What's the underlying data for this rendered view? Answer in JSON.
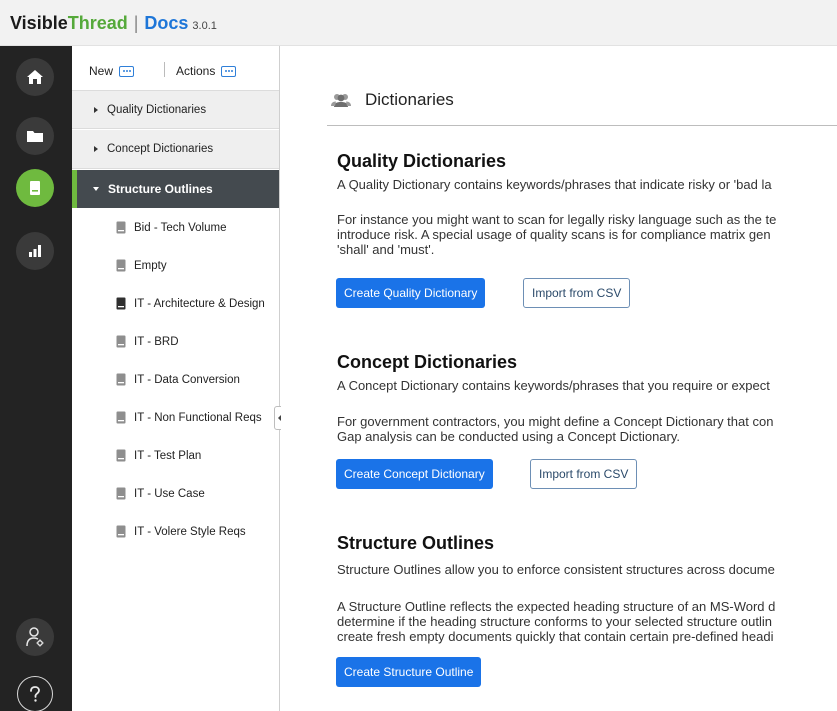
{
  "header": {
    "brand_visible": "Visible",
    "brand_thread": "Thread",
    "separator": "|",
    "product": "Docs",
    "version": "3.0.1"
  },
  "rail": {
    "items": [
      {
        "icon": "home-icon"
      },
      {
        "icon": "folder-icon"
      },
      {
        "icon": "book-icon",
        "active": true
      },
      {
        "icon": "bar-chart-icon"
      }
    ],
    "bottom": [
      {
        "icon": "user-settings-icon"
      },
      {
        "icon": "help-icon"
      }
    ]
  },
  "toolbar": {
    "new_label": "New",
    "actions_label": "Actions"
  },
  "tree": {
    "headers": [
      {
        "label": "Quality Dictionaries"
      },
      {
        "label": "Concept Dictionaries"
      },
      {
        "label": "Structure Outlines"
      }
    ],
    "items": [
      {
        "label": "Bid - Tech Volume"
      },
      {
        "label": "Empty"
      },
      {
        "label": "IT - Architecture & Design"
      },
      {
        "label": "IT - BRD"
      },
      {
        "label": "IT - Data Conversion"
      },
      {
        "label": "IT - Non Functional Reqs"
      },
      {
        "label": "IT - Test Plan"
      },
      {
        "label": "IT - Use Case"
      },
      {
        "label": "IT - Volere Style Reqs"
      }
    ]
  },
  "main": {
    "title": "Dictionaries",
    "sections": [
      {
        "heading": "Quality Dictionaries",
        "intro": "A Quality Dictionary contains keywords/phrases that indicate risky or 'bad la",
        "body": [
          "For instance you might want to scan for legally risky language such as the te",
          "introduce risk. A special usage of quality scans is for compliance matrix gen",
          "'shall' and 'must'."
        ],
        "primary_label": "Create Quality Dictionary",
        "secondary_label": "Import from CSV"
      },
      {
        "heading": "Concept Dictionaries",
        "intro": "A Concept Dictionary contains keywords/phrases that you require or expect",
        "body": [
          "For government contractors, you might define a Concept Dictionary that con",
          "Gap analysis can be conducted using a Concept Dictionary."
        ],
        "primary_label": "Create Concept Dictionary",
        "secondary_label": "Import from CSV"
      },
      {
        "heading": "Structure Outlines",
        "intro": "Structure Outlines allow you to enforce consistent structures across docume",
        "body": [
          "A Structure Outline reflects the expected heading structure of an MS-Word d",
          "determine if the heading structure conforms to your selected structure outlin",
          "create fresh empty documents quickly that contain certain pre-defined headi"
        ],
        "primary_label": "Create Structure Outline"
      }
    ]
  },
  "colors": {
    "accent_green": "#6fba3f",
    "primary_blue": "#1a73e8",
    "rail_bg": "#232323",
    "selected_row": "#444a4f"
  }
}
